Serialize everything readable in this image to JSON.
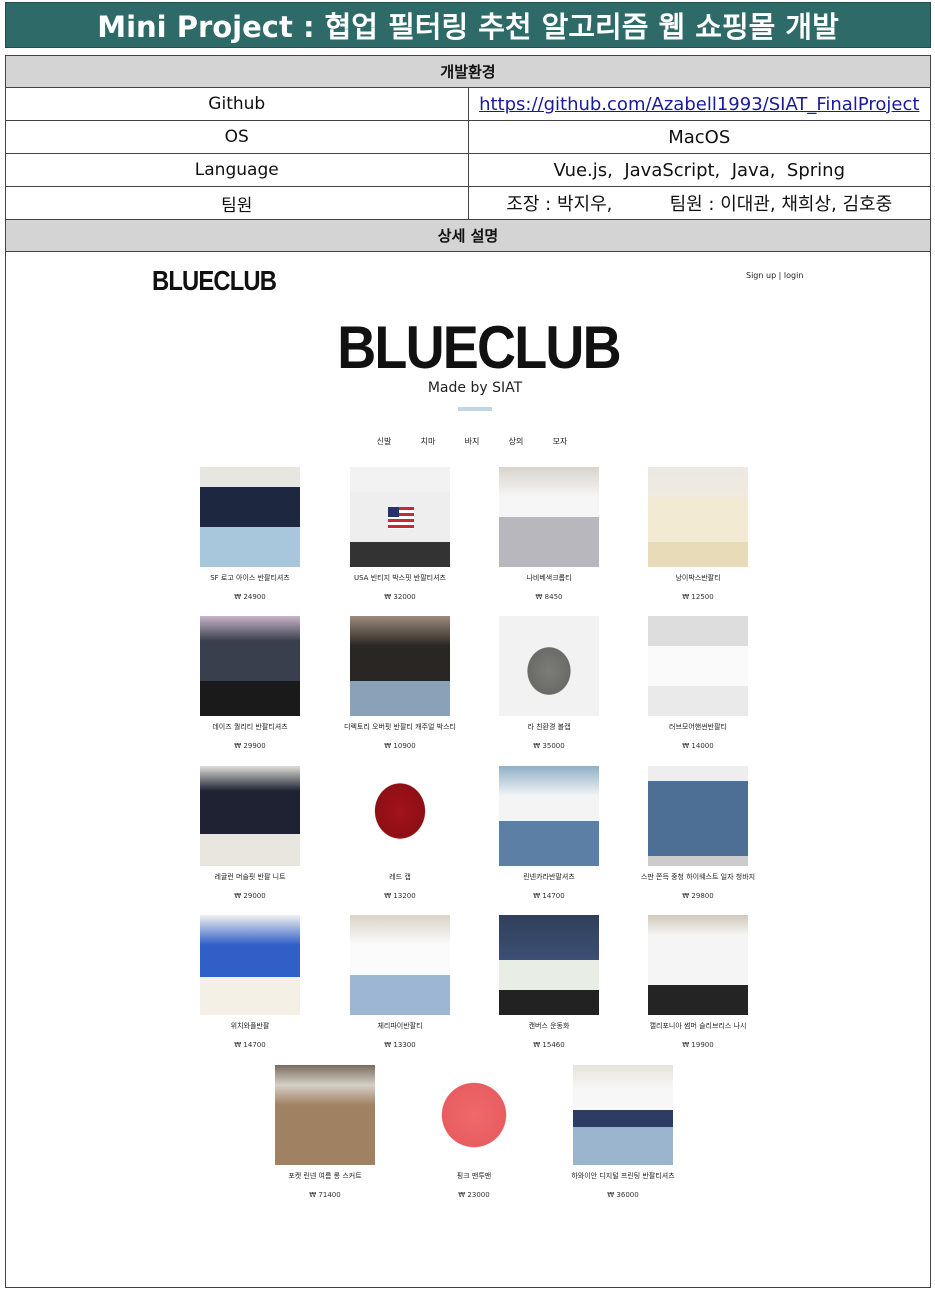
{
  "title": "Mini Project : 협업 필터링 추천 알고리즘 웹 쇼핑몰 개발",
  "env": {
    "heading": "개발환경",
    "rows": [
      {
        "key": "Github",
        "value": "https://github.com/Azabell1993/SIAT_FinalProject"
      },
      {
        "key": "OS",
        "value": "MacOS"
      },
      {
        "key": "Language",
        "value": "Vue.js,  JavaScript,  Java,  Spring"
      },
      {
        "key": "팀원",
        "value": "조장 : 박지우,          팀원 : 이대관, 채희상, 김호중"
      }
    ]
  },
  "detail_heading": "상세 설명",
  "shop": {
    "logo": "BLUECLUB",
    "auth": "Sign up | login",
    "hero_title": "BLUECLUB",
    "hero_sub": "Made by SIAT",
    "categories": [
      "신발",
      "치마",
      "바지",
      "상의",
      "모자"
    ],
    "products": [
      {
        "name": "SF 로고 아이스 반팔티셔츠",
        "price": "₩ 24900"
      },
      {
        "name": "USA 빈티지 박스핏 반팔티셔츠",
        "price": "₩ 32000"
      },
      {
        "name": "나비베색크롭티",
        "price": "₩ 8450"
      },
      {
        "name": "낭이박스반팔티",
        "price": "₩ 12500"
      },
      {
        "name": "데이즈 퀄리티 반팔티셔츠",
        "price": "₩ 29900"
      },
      {
        "name": "디렉토리 오버핏 반팔티 캐주얼 박스티",
        "price": "₩ 10900"
      },
      {
        "name": "라 친환경 볼캡",
        "price": "₩ 35000"
      },
      {
        "name": "러브모어핸썬반팔티",
        "price": "₩ 14000"
      },
      {
        "name": "레귤런 머슬핏 반팔 니트",
        "price": "₩ 29000"
      },
      {
        "name": "레드 캡",
        "price": "₩ 13200"
      },
      {
        "name": "린넨카라반팔셔츠",
        "price": "₩ 14700"
      },
      {
        "name": "스판 쫀득 중청 하이웨스트 일자 청바지",
        "price": "₩ 29800"
      },
      {
        "name": "위치와플반팔",
        "price": "₩ 14700"
      },
      {
        "name": "체리파이반팔티",
        "price": "₩ 13300"
      },
      {
        "name": "캔버스 운동화",
        "price": "₩ 15460"
      },
      {
        "name": "캘리포니아 썸머 슬리브리스 나시",
        "price": "₩ 19900"
      },
      {
        "name": "포켓 린넨 여름 롱 스커트",
        "price": "₩ 71400"
      },
      {
        "name": "핑크 맨투맨",
        "price": "₩ 23000"
      },
      {
        "name": "하와이안 디지털 프린팅 반팔티셔츠",
        "price": "₩ 36000"
      }
    ]
  },
  "colors": {
    "title_bg": "#2e6a68",
    "section_bg": "#d4d4d4",
    "link": "#1a1a9e",
    "hero_bar": "#c4d6e6"
  }
}
